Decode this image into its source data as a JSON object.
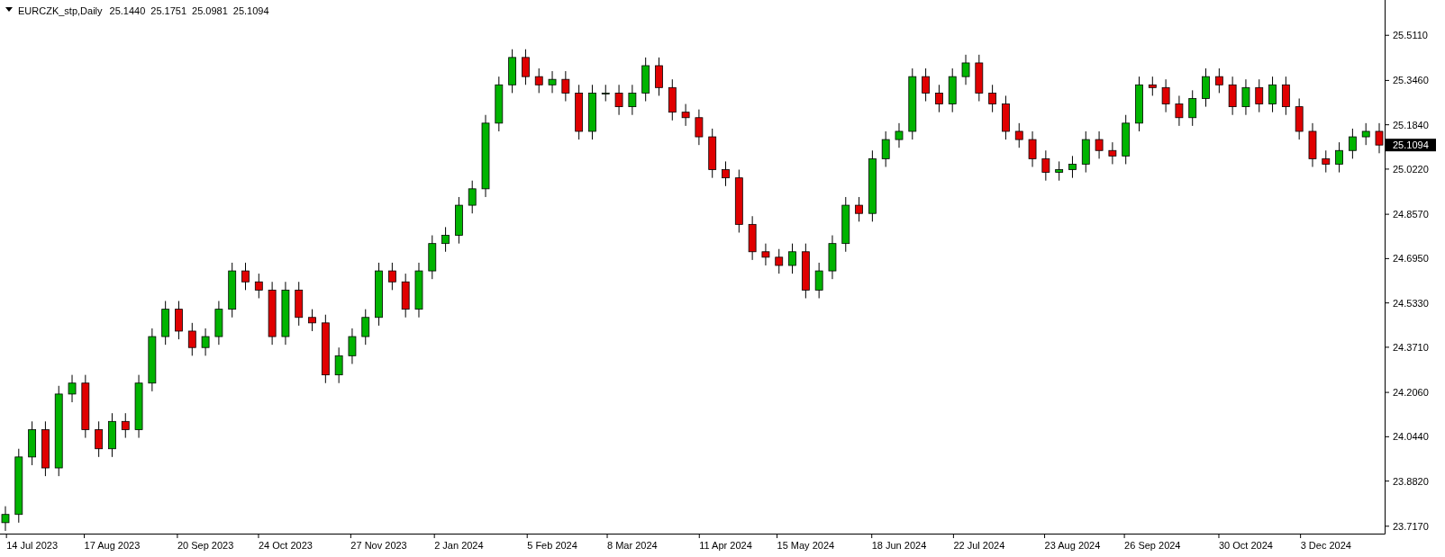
{
  "header": {
    "symbol": "EURCZK_stp,Daily",
    "ohlc": [
      "25.1440",
      "25.1751",
      "25.0981",
      "25.1094"
    ]
  },
  "chart": {
    "price_label": "25.1094",
    "chart_data": {
      "type": "candlestick",
      "ylim": [
        23.69,
        25.64
      ],
      "categories": [
        null,
        null,
        "14 Jul 2023",
        null,
        null,
        null,
        null,
        null,
        "17 Aug 2023",
        null,
        null,
        null,
        null,
        null,
        null,
        "20 Sep 2023",
        null,
        null,
        null,
        null,
        null,
        "24 Oct 2023",
        null,
        null,
        null,
        null,
        null,
        null,
        "27 Nov 2023",
        null,
        null,
        null,
        null,
        null,
        "2 Jan 2024",
        null,
        null,
        null,
        null,
        null,
        null,
        "5 Feb 2024",
        null,
        null,
        null,
        null,
        null,
        "8 Mar 2024",
        null,
        null,
        null,
        null,
        null,
        null,
        "11 Apr 2024",
        null,
        null,
        null,
        null,
        null,
        "15 May 2024",
        null,
        null,
        null,
        null,
        null,
        null,
        "18 Jun 2024",
        null,
        null,
        null,
        null,
        null,
        "22 Jul 2024",
        null,
        null,
        null,
        null,
        null,
        null,
        "23 Aug 2024",
        null,
        null,
        null,
        null,
        null,
        "26 Sep 2024",
        null,
        null,
        null,
        null,
        null,
        null,
        "30 Oct 2024",
        null,
        null,
        null,
        null,
        null,
        "3 Dec 2024",
        null,
        null,
        null,
        null
      ],
      "ohlc": [
        [
          23.73,
          23.79,
          23.7,
          23.76
        ],
        [
          23.76,
          24.0,
          23.73,
          23.97
        ],
        [
          23.97,
          24.1,
          23.94,
          24.07
        ],
        [
          24.07,
          24.1,
          23.9,
          23.93
        ],
        [
          23.93,
          24.23,
          23.9,
          24.2
        ],
        [
          24.2,
          24.27,
          24.17,
          24.24
        ],
        [
          24.24,
          24.27,
          24.04,
          24.07
        ],
        [
          24.07,
          24.1,
          23.97,
          24.0
        ],
        [
          24.0,
          24.13,
          23.97,
          24.1
        ],
        [
          24.1,
          24.13,
          24.04,
          24.07
        ],
        [
          24.07,
          24.27,
          24.04,
          24.24
        ],
        [
          24.24,
          24.44,
          24.21,
          24.41
        ],
        [
          24.41,
          24.54,
          24.38,
          24.51
        ],
        [
          24.51,
          24.54,
          24.4,
          24.43
        ],
        [
          24.43,
          24.46,
          24.34,
          24.37
        ],
        [
          24.37,
          24.44,
          24.34,
          24.41
        ],
        [
          24.41,
          24.54,
          24.38,
          24.51
        ],
        [
          24.51,
          24.68,
          24.48,
          24.65
        ],
        [
          24.65,
          24.68,
          24.58,
          24.61
        ],
        [
          24.61,
          24.64,
          24.55,
          24.58
        ],
        [
          24.58,
          24.61,
          24.38,
          24.41
        ],
        [
          24.41,
          24.61,
          24.38,
          24.58
        ],
        [
          24.58,
          24.61,
          24.45,
          24.48
        ],
        [
          24.48,
          24.51,
          24.43,
          24.46
        ],
        [
          24.46,
          24.49,
          24.24,
          24.27
        ],
        [
          24.27,
          24.37,
          24.24,
          24.34
        ],
        [
          24.34,
          24.44,
          24.31,
          24.41
        ],
        [
          24.41,
          24.51,
          24.38,
          24.48
        ],
        [
          24.48,
          24.68,
          24.45,
          24.65
        ],
        [
          24.65,
          24.68,
          24.58,
          24.61
        ],
        [
          24.61,
          24.64,
          24.48,
          24.51
        ],
        [
          24.51,
          24.68,
          24.48,
          24.65
        ],
        [
          24.65,
          24.78,
          24.62,
          24.75
        ],
        [
          24.75,
          24.81,
          24.72,
          24.78
        ],
        [
          24.78,
          24.92,
          24.75,
          24.89
        ],
        [
          24.89,
          24.98,
          24.86,
          24.95
        ],
        [
          24.95,
          25.22,
          24.92,
          25.19
        ],
        [
          25.19,
          25.36,
          25.16,
          25.33
        ],
        [
          25.33,
          25.46,
          25.3,
          25.43
        ],
        [
          25.43,
          25.46,
          25.33,
          25.36
        ],
        [
          25.36,
          25.39,
          25.3,
          25.33
        ],
        [
          25.33,
          25.38,
          25.3,
          25.35
        ],
        [
          25.35,
          25.38,
          25.27,
          25.3
        ],
        [
          25.3,
          25.33,
          25.13,
          25.16
        ],
        [
          25.16,
          25.33,
          25.13,
          25.3
        ],
        [
          25.3,
          25.33,
          25.27,
          25.3
        ],
        [
          25.3,
          25.33,
          25.22,
          25.25
        ],
        [
          25.25,
          25.33,
          25.22,
          25.3
        ],
        [
          25.3,
          25.43,
          25.27,
          25.4
        ],
        [
          25.4,
          25.43,
          25.29,
          25.32
        ],
        [
          25.32,
          25.35,
          25.2,
          25.23
        ],
        [
          25.23,
          25.26,
          25.18,
          25.21
        ],
        [
          25.21,
          25.24,
          25.11,
          25.14
        ],
        [
          25.14,
          25.17,
          24.99,
          25.02
        ],
        [
          25.02,
          25.05,
          24.96,
          24.99
        ],
        [
          24.99,
          25.02,
          24.79,
          24.82
        ],
        [
          24.82,
          24.85,
          24.69,
          24.72
        ],
        [
          24.72,
          24.75,
          24.67,
          24.7
        ],
        [
          24.7,
          24.73,
          24.64,
          24.67
        ],
        [
          24.67,
          24.75,
          24.64,
          24.72
        ],
        [
          24.72,
          24.75,
          24.55,
          24.58
        ],
        [
          24.58,
          24.68,
          24.55,
          24.65
        ],
        [
          24.65,
          24.78,
          24.62,
          24.75
        ],
        [
          24.75,
          24.92,
          24.72,
          24.89
        ],
        [
          24.89,
          24.92,
          24.83,
          24.86
        ],
        [
          24.86,
          25.09,
          24.83,
          25.06
        ],
        [
          25.06,
          25.16,
          25.03,
          25.13
        ],
        [
          25.13,
          25.19,
          25.1,
          25.16
        ],
        [
          25.16,
          25.39,
          25.13,
          25.36
        ],
        [
          25.36,
          25.39,
          25.27,
          25.3
        ],
        [
          25.3,
          25.33,
          25.23,
          25.26
        ],
        [
          25.26,
          25.39,
          25.23,
          25.36
        ],
        [
          25.36,
          25.44,
          25.33,
          25.41
        ],
        [
          25.41,
          25.44,
          25.27,
          25.3
        ],
        [
          25.3,
          25.33,
          25.23,
          25.26
        ],
        [
          25.26,
          25.29,
          25.13,
          25.16
        ],
        [
          25.16,
          25.19,
          25.1,
          25.13
        ],
        [
          25.13,
          25.16,
          25.03,
          25.06
        ],
        [
          25.06,
          25.09,
          24.98,
          25.01
        ],
        [
          25.01,
          25.05,
          24.98,
          25.02
        ],
        [
          25.02,
          25.07,
          24.99,
          25.04
        ],
        [
          25.04,
          25.16,
          25.01,
          25.13
        ],
        [
          25.13,
          25.16,
          25.06,
          25.09
        ],
        [
          25.09,
          25.12,
          25.04,
          25.07
        ],
        [
          25.07,
          25.22,
          25.04,
          25.19
        ],
        [
          25.19,
          25.36,
          25.16,
          25.33
        ],
        [
          25.33,
          25.36,
          25.29,
          25.32
        ],
        [
          25.32,
          25.35,
          25.23,
          25.26
        ],
        [
          25.26,
          25.29,
          25.18,
          25.21
        ],
        [
          25.21,
          25.31,
          25.18,
          25.28
        ],
        [
          25.28,
          25.39,
          25.25,
          25.36
        ],
        [
          25.36,
          25.39,
          25.3,
          25.33
        ],
        [
          25.33,
          25.36,
          25.22,
          25.25
        ],
        [
          25.25,
          25.35,
          25.22,
          25.32
        ],
        [
          25.32,
          25.35,
          25.23,
          25.26
        ],
        [
          25.26,
          25.36,
          25.23,
          25.33
        ],
        [
          25.33,
          25.36,
          25.22,
          25.25
        ],
        [
          25.25,
          25.28,
          25.13,
          25.16
        ],
        [
          25.16,
          25.19,
          25.03,
          25.06
        ],
        [
          25.06,
          25.09,
          25.01,
          25.04
        ],
        [
          25.04,
          25.12,
          25.01,
          25.09
        ],
        [
          25.09,
          25.17,
          25.06,
          25.14
        ],
        [
          25.14,
          25.19,
          25.11,
          25.16
        ],
        [
          25.16,
          25.19,
          25.08,
          25.11
        ]
      ],
      "yticks": [
        {
          "value": 25.511,
          "label": "25.5110"
        },
        {
          "value": 25.346,
          "label": "25.3460"
        },
        {
          "value": 25.184,
          "label": "25.1840"
        },
        {
          "value": 25.022,
          "label": "25.0220"
        },
        {
          "value": 24.857,
          "label": "24.8570"
        },
        {
          "value": 24.695,
          "label": "24.6950"
        },
        {
          "value": 24.533,
          "label": "24.5330"
        },
        {
          "value": 24.371,
          "label": "24.3710"
        },
        {
          "value": 24.206,
          "label": "24.2060"
        },
        {
          "value": 24.044,
          "label": "24.0440"
        },
        {
          "value": 23.882,
          "label": "23.8820"
        },
        {
          "value": 23.717,
          "label": "23.7170"
        }
      ]
    }
  }
}
